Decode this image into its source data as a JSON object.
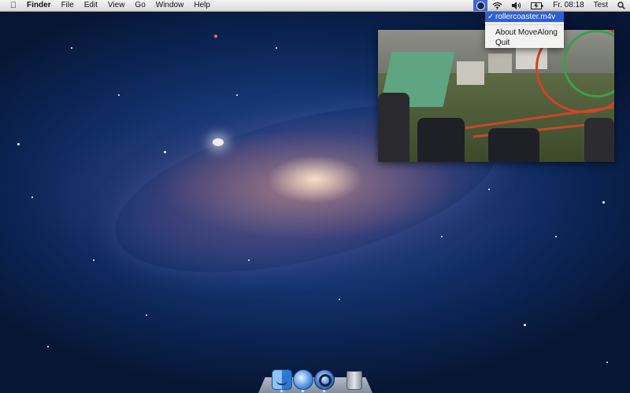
{
  "menubar": {
    "apple_icon": "apple-icon",
    "app_name": "Finder",
    "menus": [
      "File",
      "Edit",
      "View",
      "Go",
      "Window",
      "Help"
    ],
    "status": {
      "movealong_icon": "movealong-menu-icon",
      "wifi_icon": "wifi-icon",
      "volume_icon": "volume-icon",
      "battery_icon": "battery-icon",
      "clock": "Fr. 08:18",
      "user": "Test",
      "spotlight_icon": "spotlight-icon"
    }
  },
  "dropdown": {
    "selected_item": "rollercoaster.m4v",
    "items": [
      "About MoveAlong",
      "Quit"
    ]
  },
  "dock": {
    "items": [
      "finder-icon",
      "movealong-icon",
      "quicktime-icon",
      "trash-icon"
    ]
  },
  "colors": {
    "menu_highlight": "#2e5fd6",
    "desktop_bg": "#143672"
  }
}
